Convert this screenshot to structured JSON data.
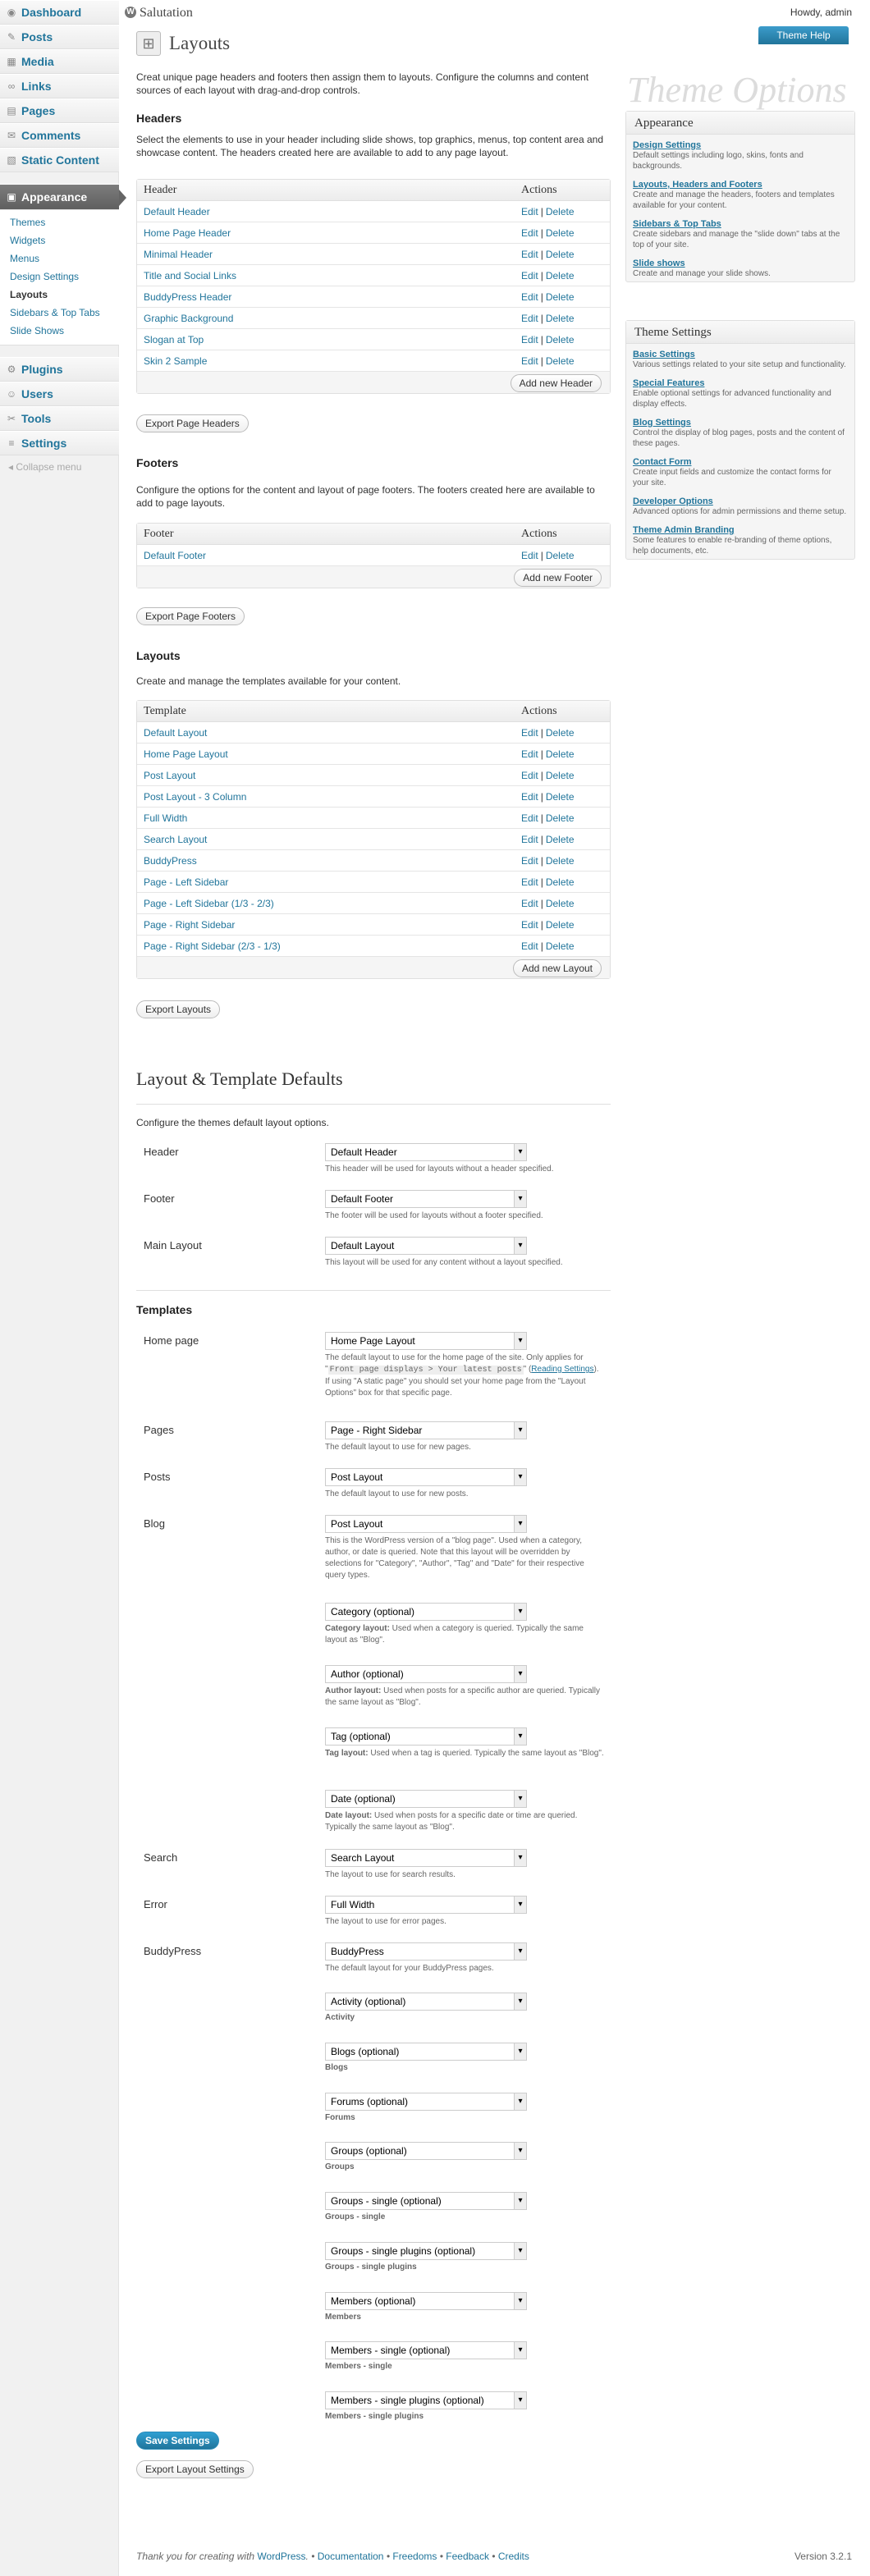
{
  "header": {
    "site_title": "Salutation",
    "howdy": "Howdy, admin",
    "help_button": "Theme Help"
  },
  "menu": {
    "top": [
      {
        "label": "Dashboard",
        "icon": "dashboard-icon"
      },
      {
        "label": "Posts",
        "icon": "posts-icon"
      },
      {
        "label": "Media",
        "icon": "media-icon"
      },
      {
        "label": "Links",
        "icon": "links-icon"
      },
      {
        "label": "Pages",
        "icon": "pages-icon"
      },
      {
        "label": "Comments",
        "icon": "comments-icon"
      },
      {
        "label": "Static Content",
        "icon": "static-content-icon"
      }
    ],
    "appearance": "Appearance",
    "appearance_sub": [
      "Themes",
      "Widgets",
      "Menus",
      "Design Settings",
      "Layouts",
      "Sidebars & Top Tabs",
      "Slide Shows"
    ],
    "bottom": [
      {
        "label": "Plugins",
        "icon": "plugins-icon"
      },
      {
        "label": "Users",
        "icon": "users-icon"
      },
      {
        "label": "Tools",
        "icon": "tools-icon"
      },
      {
        "label": "Settings",
        "icon": "settings-icon"
      }
    ],
    "collapse": "Collapse menu"
  },
  "page": {
    "title": "Layouts",
    "intro": "Creat unique page headers and footers then assign them to layouts. Configure the columns and content sources of each layout with drag-and-drop controls."
  },
  "headers": {
    "title": "Headers",
    "desc": "Select the elements to use in your header including slide shows, top graphics, menus, top content area and showcase content. The headers created here are available to add to any page layout.",
    "col_name": "Header",
    "col_actions": "Actions",
    "rows": [
      "Default Header",
      "Home Page Header",
      "Minimal Header",
      "Title and Social Links",
      "BuddyPress Header",
      "Graphic Background",
      "Slogan at Top",
      "Skin 2 Sample"
    ],
    "edit": "Edit",
    "delete": "Delete",
    "sep": "|",
    "add_button": "Add new Header",
    "export_button": "Export Page Headers"
  },
  "footers": {
    "title": "Footers",
    "desc": "Configure the options for the content and layout of page footers. The footers created here are available to add to page layouts.",
    "col_name": "Footer",
    "col_actions": "Actions",
    "rows": [
      "Default Footer"
    ],
    "add_button": "Add new Footer",
    "export_button": "Export Page Footers"
  },
  "layouts": {
    "title": "Layouts",
    "desc": "Create and manage the templates available for your content.",
    "col_name": "Template",
    "col_actions": "Actions",
    "rows": [
      "Default Layout",
      "Home Page Layout",
      "Post Layout",
      "Post Layout - 3 Column",
      "Full Width",
      "Search Layout",
      "BuddyPress",
      "Page - Left Sidebar",
      "Page - Left Sidebar (1/3 - 2/3)",
      "Page - Right Sidebar",
      "Page - Right Sidebar (2/3 - 1/3)"
    ],
    "add_button": "Add new Layout",
    "export_button": "Export Layouts"
  },
  "defaults": {
    "title": "Layout & Template Defaults",
    "desc": "Configure the themes default layout options.",
    "fields": [
      {
        "label": "Header",
        "value": "Default Header",
        "hint": "This header will be used for layouts without a header specified."
      },
      {
        "label": "Footer",
        "value": "Default Footer",
        "hint": "The footer will be used for layouts without a footer specified."
      },
      {
        "label": "Main Layout",
        "value": "Default Layout",
        "hint": "This layout will be used for any content without a layout specified."
      }
    ]
  },
  "templates": {
    "title": "Templates",
    "home": {
      "label": "Home page",
      "value": "Home Page Layout",
      "hint_a": "The default layout to use for the home page of the site. Only applies for \"",
      "hint_code": "Front page displays > Your latest posts",
      "hint_b": "\" (",
      "hint_link": "Reading Settings",
      "hint_c": "). If using \"A static page\" you should set your home page from the \"Layout Options\" box for that specific page."
    },
    "pages": {
      "label": "Pages",
      "value": "Page - Right Sidebar",
      "hint": "The default layout to use for new pages."
    },
    "posts": {
      "label": "Posts",
      "value": "Post Layout",
      "hint": "The default layout to use for new posts."
    },
    "blog": {
      "label": "Blog",
      "value": "Post Layout",
      "hint": "This is the WordPress version of a \"blog page\". Used when a category, author, or date is queried. Note that this layout will be overridden by selections for \"Category\", \"Author\", \"Tag\" and \"Date\" for their respective query types."
    },
    "blog_sub": [
      {
        "value": "Category (optional)",
        "hint_b": "Category layout:",
        "hint": " Used when a category is queried. Typically the same layout as \"Blog\"."
      },
      {
        "value": "Author (optional)",
        "hint_b": "Author layout:",
        "hint": " Used when posts for a specific author are queried. Typically the same layout as \"Blog\"."
      },
      {
        "value": "Tag (optional)",
        "hint_b": "Tag layout:",
        "hint": " Used when a tag is queried. Typically the same layout as \"Blog\"."
      },
      {
        "value": "Date (optional)",
        "hint_b": "Date layout:",
        "hint": " Used when posts for a specific date or time are queried. Typically the same layout as \"Blog\"."
      }
    ],
    "search": {
      "label": "Search",
      "value": "Search Layout",
      "hint": "The layout to use for search results."
    },
    "error": {
      "label": "Error",
      "value": "Full Width",
      "hint": "The layout to use for error pages."
    },
    "buddypress": {
      "label": "BuddyPress",
      "value": "BuddyPress",
      "hint": "The default layout for your BuddyPress pages."
    },
    "bp_sub": [
      {
        "value": "Activity (optional)",
        "hint": "Activity"
      },
      {
        "value": "Blogs (optional)",
        "hint": "Blogs"
      },
      {
        "value": "Forums (optional)",
        "hint": "Forums"
      },
      {
        "value": "Groups (optional)",
        "hint": "Groups"
      },
      {
        "value": "Groups - single (optional)",
        "hint": "Groups - single"
      },
      {
        "value": "Groups - single plugins (optional)",
        "hint": "Groups - single plugins"
      },
      {
        "value": "Members (optional)",
        "hint": "Members"
      },
      {
        "value": "Members - single (optional)",
        "hint": "Members - single"
      },
      {
        "value": "Members - single plugins (optional)",
        "hint": "Members - single plugins"
      }
    ],
    "save_button": "Save Settings",
    "export_button": "Export Layout Settings"
  },
  "sidebar": {
    "watermark": "Theme Options",
    "appearance": {
      "title": "Appearance",
      "items": [
        {
          "link": "Design Settings",
          "desc": "Default settings including logo, skins, fonts and backgrounds."
        },
        {
          "link": "Layouts, Headers and Footers",
          "desc": "Create and manage the headers, footers and templates available for your content."
        },
        {
          "link": "Sidebars & Top Tabs",
          "desc": "Create sidebars and manage the \"slide down\" tabs at the top of your site."
        },
        {
          "link": "Slide shows",
          "desc": "Create and manage your slide shows."
        }
      ]
    },
    "theme_settings": {
      "title": "Theme Settings",
      "items": [
        {
          "link": "Basic Settings",
          "desc": "Various settings related to your site setup and functionality."
        },
        {
          "link": "Special Features",
          "desc": "Enable optional settings for advanced functionality and display effects."
        },
        {
          "link": "Blog Settings",
          "desc": "Control the display of blog pages, posts and the content of these pages."
        },
        {
          "link": "Contact Form",
          "desc": "Create input fields and customize the contact forms for your site."
        },
        {
          "link": "Developer Options",
          "desc": "Advanced options for admin permissions and theme setup."
        },
        {
          "link": "Theme Admin Branding",
          "desc": "Some features to enable re-branding of theme options, help documents, etc."
        }
      ]
    }
  },
  "footer": {
    "thanks": "Thank you for creating with ",
    "wp": "WordPress",
    "dot1": ".",
    "sep": " • ",
    "docs": "Documentation",
    "freedoms": "Freedoms",
    "feedback": "Feedback",
    "credits": "Credits",
    "version": "Version 3.2.1"
  }
}
